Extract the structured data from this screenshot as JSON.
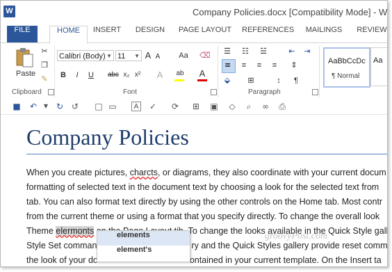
{
  "app": {
    "logo_letter": "W",
    "title": "Company Policies.docx [Compatibility Mode] - Word"
  },
  "tabs": [
    "FILE",
    "HOME",
    "INSERT",
    "DESIGN",
    "PAGE LAYOUT",
    "REFERENCES",
    "MAILINGS",
    "REVIEW"
  ],
  "ribbon": {
    "clipboard": {
      "paste_label": "Paste",
      "group_label": "Clipboard"
    },
    "font": {
      "font_name": "Calibri (Body)",
      "font_size": "11",
      "group_label": "Font",
      "bold": "B",
      "italic": "I",
      "underline": "U",
      "strikethrough": "abc",
      "subscript": "x₂",
      "superscript": "x²",
      "grow": "A",
      "shrink": "A",
      "change_case": "Aa",
      "text_effects": "A",
      "highlight": "ab",
      "font_color": "A"
    },
    "paragraph": {
      "group_label": "Paragraph"
    },
    "styles": [
      {
        "preview": "AaBbCcDc",
        "name": "¶ Normal"
      },
      {
        "preview": "Aa",
        "name": ""
      }
    ]
  },
  "document": {
    "heading": "Company Policies",
    "lines": [
      [
        "When you create pictures, ",
        "charcts",
        ", or diagrams, they also coordinate with your current docum"
      ],
      [
        "formatting of selected text in the document text by choosing a look for the selected text from"
      ],
      [
        "tab. You can also format text directly by using the other controls on the Home tab. Most contr"
      ],
      [
        "from the current theme or using a format that you specify directly. To change the overall look"
      ],
      [
        "Theme ",
        "elermonts",
        " on the Page Layout ",
        "tib",
        ". To change the looks available in the Quick Style galle"
      ],
      [
        "Style Set comman",
        "ry and the Quick Styles gallery provide reset comm"
      ],
      [
        "the look of your do",
        "ontained in your current template. On the Insert ta"
      ]
    ]
  },
  "spelling_popup": {
    "suggestions": [
      "elements",
      "element's"
    ]
  },
  "watermark": "groovyPost.com",
  "colors": {
    "accent": "#2b579a",
    "heading": "#1f3e6b",
    "font_color_bar": "#e00000",
    "highlight_bar": "#ffff00"
  }
}
